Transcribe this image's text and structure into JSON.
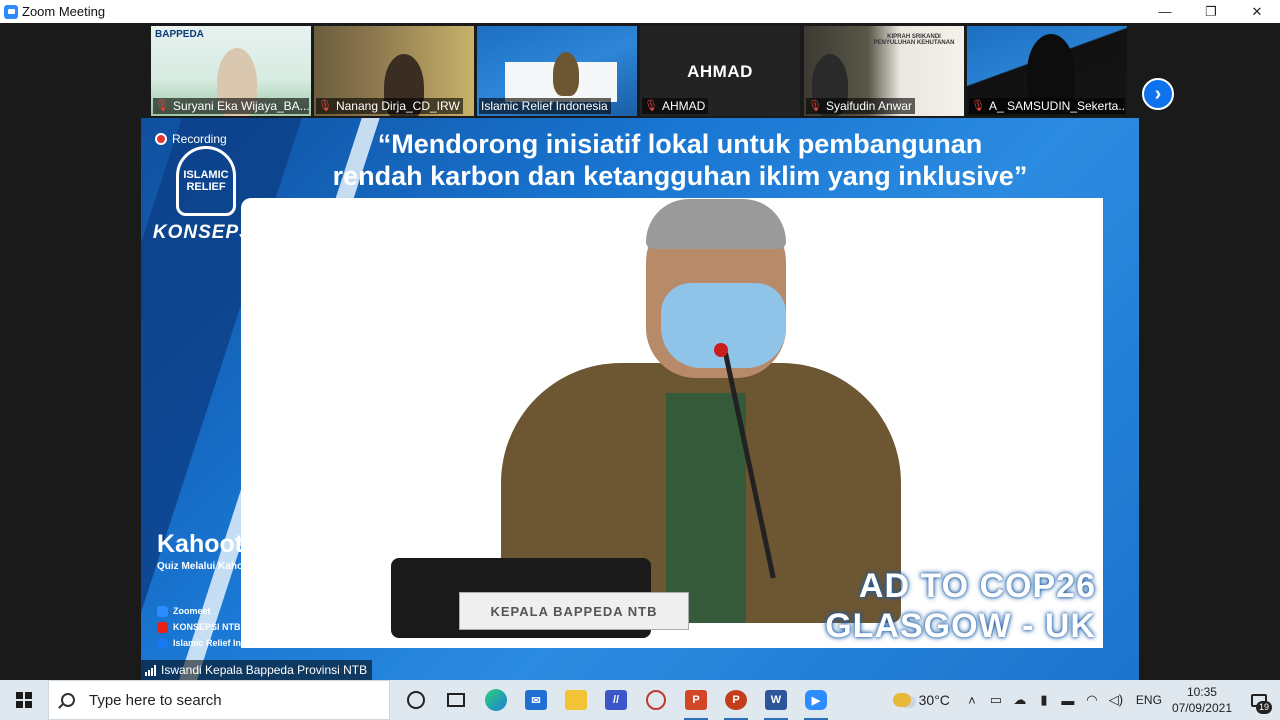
{
  "window": {
    "title": "Zoom Meeting",
    "controls": {
      "minimize": "—",
      "restore": "❐",
      "close": "✕"
    }
  },
  "gallery": {
    "participants": [
      {
        "name": "Suryani Eka Wijaya_BA...",
        "muted": true,
        "tile_text": "BAPPEDA"
      },
      {
        "name": "Nanang Dirja_CD_IRW",
        "muted": true
      },
      {
        "name": "Islamic Relief Indonesia",
        "muted": false
      },
      {
        "name": "AHMAD",
        "muted": true,
        "display_text": "AHMAD"
      },
      {
        "name": "Syaifudin Anwar",
        "muted": true,
        "tile_text": "KIPRAH SRIKANDI PENYULUHAN KEHUTANAN"
      },
      {
        "name": "A_ SAMSUDIN_Sekerta...",
        "muted": true
      }
    ],
    "next_page_icon": "chevron-right-icon"
  },
  "main": {
    "recording_label": "Recording",
    "quote_line1": "“Mendorong inisiatif lokal untuk pembangunan",
    "quote_line2": "rendah karbon dan ketangguhan iklim yang inklusive”",
    "logo_mark": "ISLAMIC RELIEF",
    "logo_text": "KONSEPSI",
    "kahoot_title": "Kahoot!",
    "kahoot_sub": "Quiz Melalui Kahoot.it",
    "socials": [
      {
        "label": "Zoomeet",
        "color": "#2d8cff"
      },
      {
        "label": "KONSEPSI NTB",
        "color": "#e62117"
      },
      {
        "label": "Islamic Relief Indonesia",
        "color": "#1877f2"
      }
    ],
    "nameplate": "KEPALA BAPPEDA NTB",
    "banner_line1": "AD TO COP26",
    "banner_line2": "GLASGOW - UK",
    "speaker_name": "Iswandi Kepala Bappeda Provinsi NTB"
  },
  "taskbar": {
    "search_placeholder": "Type here to search",
    "apps": [
      "task-view",
      "edge",
      "mail",
      "file-explorer",
      "vpn-app",
      "snipping-tool",
      "powerpoint",
      "powerpoint-2",
      "word",
      "zoom"
    ],
    "weather_temp": "30°C",
    "language": "ENG",
    "time": "10:35",
    "date": "07/09/2021",
    "notification_count": "19"
  },
  "colors": {
    "zoom_blue": "#0e72ed",
    "mute_red": "#e0463c",
    "slide_blue": "#1976d2"
  }
}
